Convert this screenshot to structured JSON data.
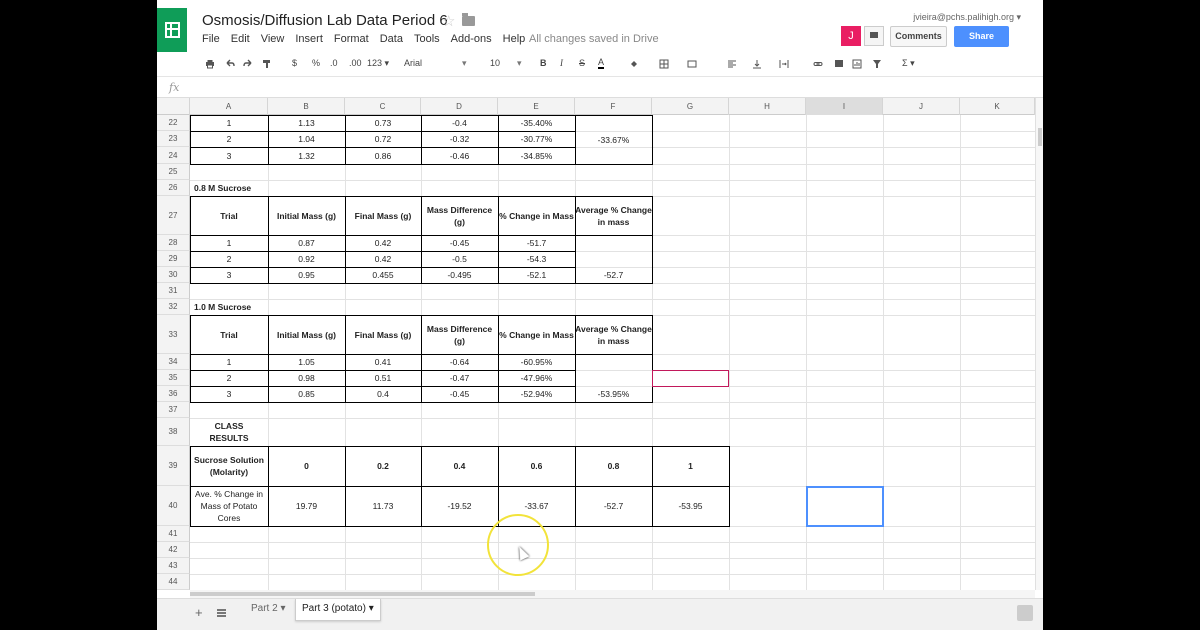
{
  "doc": {
    "title": "Osmosis/Diffusion Lab Data Period 6",
    "save_status": "All changes saved in Drive",
    "account": "jvieira@pchs.palihigh.org ▾",
    "avatar_letter": "J",
    "comments_label": "Comments",
    "share_label": "Share"
  },
  "menus": [
    "File",
    "Edit",
    "View",
    "Insert",
    "Format",
    "Data",
    "Tools",
    "Add-ons",
    "Help"
  ],
  "toolbar": {
    "currency": "$",
    "percent": "%",
    "dec_less": ".0",
    "dec_more": ".00",
    "more_formats": "123 ▾",
    "font_family": "Arial",
    "font_size": "10",
    "bold": "B",
    "italic": "I",
    "strike": "S",
    "text_color": "A",
    "sum": "Σ ▾"
  },
  "formula_bar": {
    "fx": "fx"
  },
  "columns": [
    "A",
    "B",
    "C",
    "D",
    "E",
    "F",
    "G",
    "H",
    "I",
    "J",
    "K"
  ],
  "rows": [
    "22",
    "23",
    "24",
    "25",
    "26",
    "27",
    "28",
    "29",
    "30",
    "31",
    "32",
    "33",
    "34",
    "35",
    "36",
    "37",
    "38",
    "39",
    "40",
    "41",
    "42",
    "43",
    "44"
  ],
  "sheet": {
    "t1": [
      [
        "1",
        "1.13",
        "0.73",
        "-0.4",
        "-35.40%"
      ],
      [
        "2",
        "1.04",
        "0.72",
        "-0.32",
        "-30.77%"
      ],
      [
        "3",
        "1.32",
        "0.86",
        "-0.46",
        "-34.85%"
      ]
    ],
    "t1_avg": "-33.67%",
    "sec2_title": "0.8 M Sucrose",
    "headers": [
      "Trial",
      "Initial Mass (g)",
      "Final Mass (g)",
      "Mass Difference (g)",
      "% Change in Mass",
      "Average % Change in mass"
    ],
    "t2": [
      [
        "1",
        "0.87",
        "0.42",
        "-0.45",
        "-51.7"
      ],
      [
        "2",
        "0.92",
        "0.42",
        "-0.5",
        "-54.3"
      ],
      [
        "3",
        "0.95",
        "0.455",
        "-0.495",
        "-52.1"
      ]
    ],
    "t2_avg": "-52.7",
    "sec3_title": "1.0 M Sucrose",
    "t3": [
      [
        "1",
        "1.05",
        "0.41",
        "-0.64",
        "-60.95%"
      ],
      [
        "2",
        "0.98",
        "0.51",
        "-0.47",
        "-47.96%"
      ],
      [
        "3",
        "0.85",
        "0.4",
        "-0.45",
        "-52.94%"
      ]
    ],
    "t3_avg": "-53.95%",
    "class_title": "CLASS RESULTS",
    "class_row1_label": "Sucrose Solution (Molarity)",
    "class_row1": [
      "0",
      "0.2",
      "0.4",
      "0.6",
      "0.8",
      "1"
    ],
    "class_row2_label": "Ave. % Change in Mass of Potato Cores",
    "class_row2": [
      "19.79",
      "11.73",
      "-19.52",
      "-33.67",
      "-52.7",
      "-53.95"
    ]
  },
  "tabs": [
    "Part 2 ▾",
    "Part 3 (potato) ▾"
  ]
}
